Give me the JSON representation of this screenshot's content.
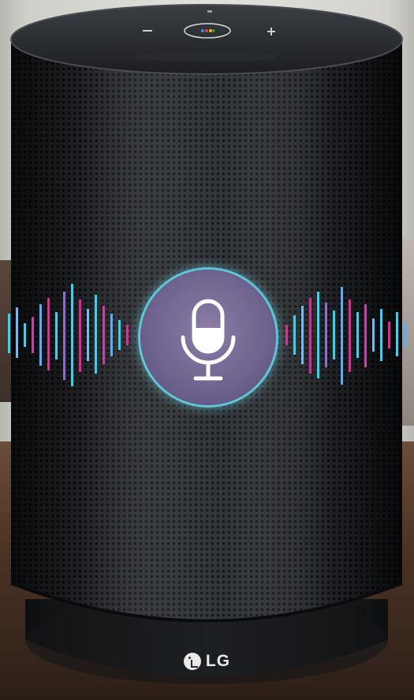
{
  "brand": {
    "name": "LG"
  },
  "colors": {
    "speaker_body": "#1f2124",
    "mic_button": "#7a6f98",
    "ring": "#5fc6d9",
    "wave_cyan": "#4fc8e0",
    "wave_magenta": "#c13a8e"
  },
  "icons": {
    "center": "microphone-icon",
    "top_left": "mute-icon",
    "top_center": "google-assistant-button-icon",
    "top_right": "volume-up-icon"
  }
}
